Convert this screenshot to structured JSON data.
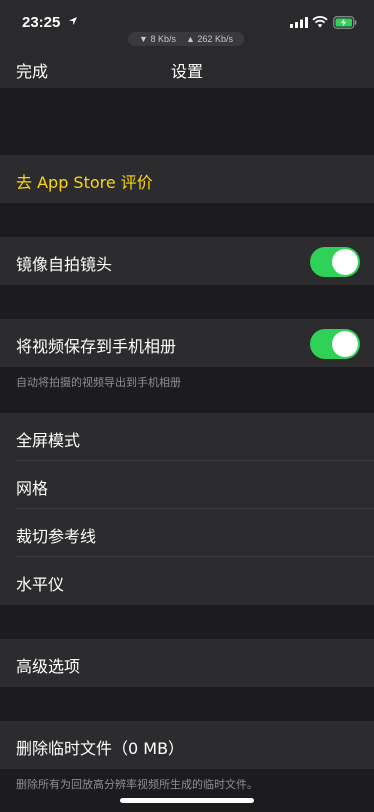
{
  "status_bar": {
    "time": "23:25",
    "down_speed": "8 Kb/s",
    "up_speed": "262 Kb/s",
    "down_arrow": "▼",
    "up_arrow": "▲"
  },
  "nav": {
    "done_label": "完成",
    "title": "设置"
  },
  "rows": {
    "app_store": "去 App Store 评价",
    "mirror_selfie": "镜像自拍镜头",
    "save_to_album": "将视频保存到手机相册",
    "save_footnote": "自动将拍摄的视频导出到手机相册",
    "fullscreen": "全屏模式",
    "grid": "网格",
    "crop_guides": "裁切参考线",
    "level": "水平仪",
    "advanced": "高级选项",
    "delete_temp": "删除临时文件（0 MB）",
    "delete_footnote": "删除所有为回放高分辨率视频所生成的临时文件。"
  },
  "toggles": {
    "mirror_selfie_on": true,
    "save_to_album_on": true
  },
  "colors": {
    "accent_yellow": "#ffd60a",
    "toggle_green": "#30d158",
    "background": "#1c1c1e",
    "cell": "#2c2c2e"
  },
  "icons": [
    "location-arrow-icon",
    "signal-icon",
    "wifi-icon",
    "battery-charging-icon"
  ]
}
